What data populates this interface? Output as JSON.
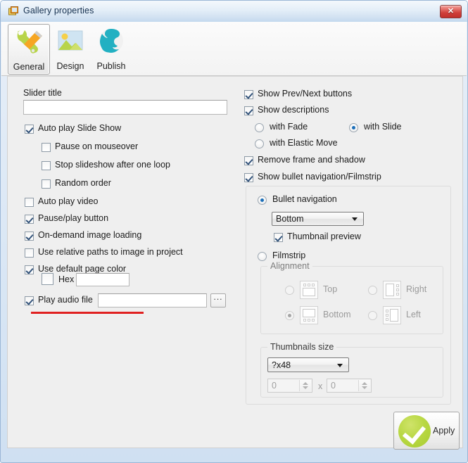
{
  "window": {
    "title": "Gallery properties",
    "app_icon": "gallery-photos-icon",
    "close_label": "✕"
  },
  "tabs": [
    {
      "label": "General",
      "icon": "wrench-screwdriver-icon",
      "selected": true
    },
    {
      "label": "Design",
      "icon": "landscape-picture-icon",
      "selected": false
    },
    {
      "label": "Publish",
      "icon": "globe-world-icon",
      "selected": false
    }
  ],
  "left_panel": {
    "slider_title_label": "Slider title",
    "slider_title_value": "",
    "slider_title_placeholder": "",
    "checkboxes": [
      {
        "label": "Auto play Slide Show",
        "checked": true,
        "disabled": false
      },
      {
        "label": "Pause on mouseover",
        "checked": false,
        "disabled": false
      },
      {
        "label": "Stop slideshow after one loop",
        "checked": false,
        "disabled": false
      },
      {
        "label": "Random order",
        "checked": false,
        "disabled": false
      },
      {
        "label": "Auto play video",
        "checked": false,
        "disabled": false
      },
      {
        "label": "Pause/play button",
        "checked": true,
        "disabled": false
      },
      {
        "label": "On-demand image loading",
        "checked": true,
        "disabled": false
      },
      {
        "label": "Use relative paths to image in project",
        "checked": false,
        "disabled": false
      },
      {
        "label": "Use default page color",
        "checked": true,
        "disabled": false
      },
      {
        "label": "Hex",
        "checked": false,
        "disabled": false
      },
      {
        "label": "Play audio file",
        "checked": true,
        "disabled": false
      }
    ],
    "hex_value": "",
    "audio_value": "",
    "browse_label": "...",
    "highlight_color": "#e02020"
  },
  "right_panel": {
    "show_prev_next": {
      "label": "Show Prev/Next buttons",
      "checked": true
    },
    "show_descriptions": {
      "label": "Show descriptions",
      "checked": true
    },
    "description_effects": [
      {
        "label": "with Fade",
        "selected": false
      },
      {
        "label": "with Slide",
        "selected": true
      },
      {
        "label": "with Elastic Move",
        "selected": false
      }
    ],
    "remove_frame": {
      "label": "Remove frame and shadow",
      "checked": true
    },
    "show_bullet_nav": {
      "label": "Show bullet navigation/Filmstrip",
      "checked": true
    },
    "nav_mode": [
      {
        "label": "Bullet navigation",
        "selected": true
      },
      {
        "label": "Filmstrip",
        "selected": false
      }
    ],
    "bullet_position_value": "Bottom",
    "thumbnail_preview": {
      "label": "Thumbnail preview",
      "checked": true
    },
    "alignment": {
      "title": "Alignment",
      "options": [
        {
          "label": "Top",
          "selected": false,
          "icon": "align-top-icon"
        },
        {
          "label": "Right",
          "selected": false,
          "icon": "align-right-icon"
        },
        {
          "label": "Bottom",
          "selected": true,
          "icon": "align-bottom-icon"
        },
        {
          "label": "Left",
          "selected": false,
          "icon": "align-left-icon"
        }
      ]
    },
    "thumbnails_size": {
      "title": "Thumbnails size",
      "preset_value": "?x48",
      "width_value": "0",
      "height_value": "0",
      "separator": "x"
    }
  },
  "footer": {
    "apply_label": "Apply"
  }
}
